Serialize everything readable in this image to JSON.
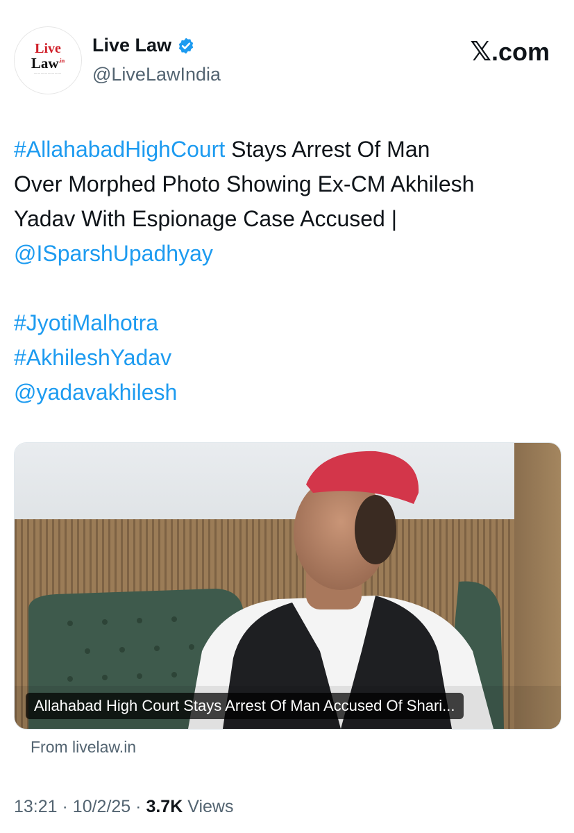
{
  "author": {
    "display_name": "Live Law",
    "handle": "@LiveLawIndia",
    "avatar_logo_text": {
      "live": "Live",
      "law": "Law",
      "suffix": ".in"
    },
    "verified": true
  },
  "brand": {
    "site": ".com"
  },
  "tweet": {
    "segments": [
      {
        "text": "#AllahabadHighCourt",
        "type": "link"
      },
      {
        "text": " Stays Arrest Of Man",
        "type": "text"
      }
    ],
    "line2": "Over Morphed Photo Showing Ex-CM Akhilesh",
    "line3": "Yadav With Espionage Case Accused |",
    "mention1": "@ISparshUpadhyay",
    "hashtag1": "#JyotiMalhotra",
    "hashtag2": "#AkhileshYadav",
    "mention2": "@yadavakhilesh"
  },
  "card": {
    "caption": "Allahabad High Court Stays Arrest Of Man Accused Of Shari...",
    "source": "From livelaw.in"
  },
  "meta": {
    "time": "13:21",
    "date": "10/2/25",
    "views_count": "3.7K",
    "views_label": "Views",
    "separator": "·"
  },
  "colors": {
    "link": "#1d9bf0",
    "text": "#0f1419",
    "muted": "#536471",
    "verified": "#1d9bf0",
    "cap_red": "#d3364a"
  }
}
